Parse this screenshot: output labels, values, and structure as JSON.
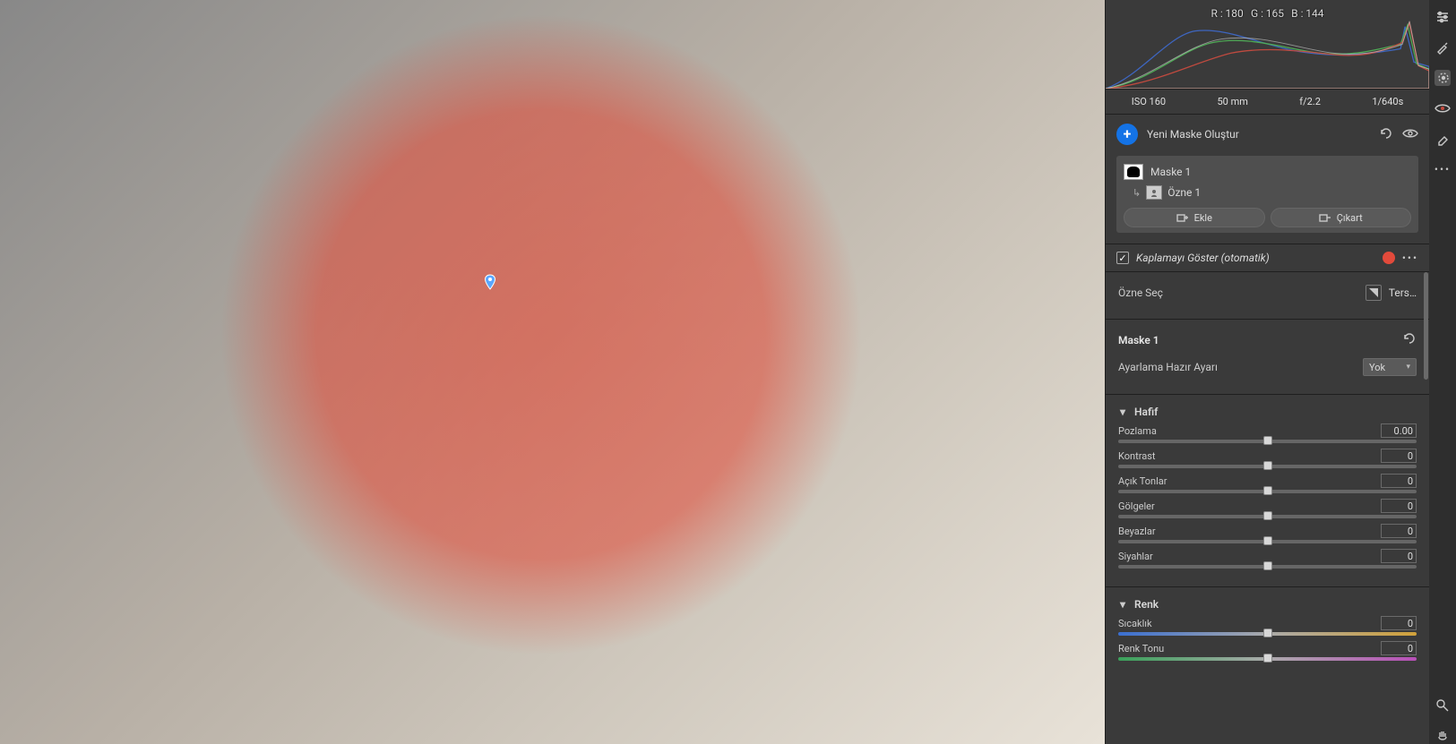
{
  "rgb": {
    "r_label": "R :",
    "r": 180,
    "g_label": "G :",
    "g": 165,
    "b_label": "B :",
    "b": 144
  },
  "meta": {
    "iso": "ISO 160",
    "focal": "50 mm",
    "aperture": "f/2.2",
    "shutter": "1/640s"
  },
  "mask_panel": {
    "new_label": "Yeni Maske Oluştur",
    "mask_name": "Maske 1",
    "subject_name": "Özne 1",
    "add_label": "Ekle",
    "subtract_label": "Çıkart"
  },
  "overlay": {
    "label": "Kaplamayı Göster (otomatik)"
  },
  "subject_select": {
    "label": "Özne Seç",
    "invert": "Ters…"
  },
  "mask_adjust": {
    "title": "Maske 1",
    "preset_label": "Ayarlama Hazır Ayarı",
    "preset_value": "Yok"
  },
  "groups": {
    "light": "Hafif",
    "color": "Renk"
  },
  "sliders": {
    "exposure": {
      "name": "Pozlama",
      "value": "0.00",
      "pos": 50
    },
    "contrast": {
      "name": "Kontrast",
      "value": "0",
      "pos": 50
    },
    "highlights": {
      "name": "Açık Tonlar",
      "value": "0",
      "pos": 50
    },
    "shadows": {
      "name": "Gölgeler",
      "value": "0",
      "pos": 50
    },
    "whites": {
      "name": "Beyazlar",
      "value": "0",
      "pos": 50
    },
    "blacks": {
      "name": "Siyahlar",
      "value": "0",
      "pos": 50
    },
    "temp": {
      "name": "Sıcaklık",
      "value": "0",
      "pos": 50
    },
    "tint": {
      "name": "Renk Tonu",
      "value": "0",
      "pos": 50
    }
  },
  "rail_icons": [
    "sliders",
    "eyedropper",
    "radial",
    "redeye",
    "eraser",
    "more",
    "zoom",
    "hand-pan"
  ]
}
